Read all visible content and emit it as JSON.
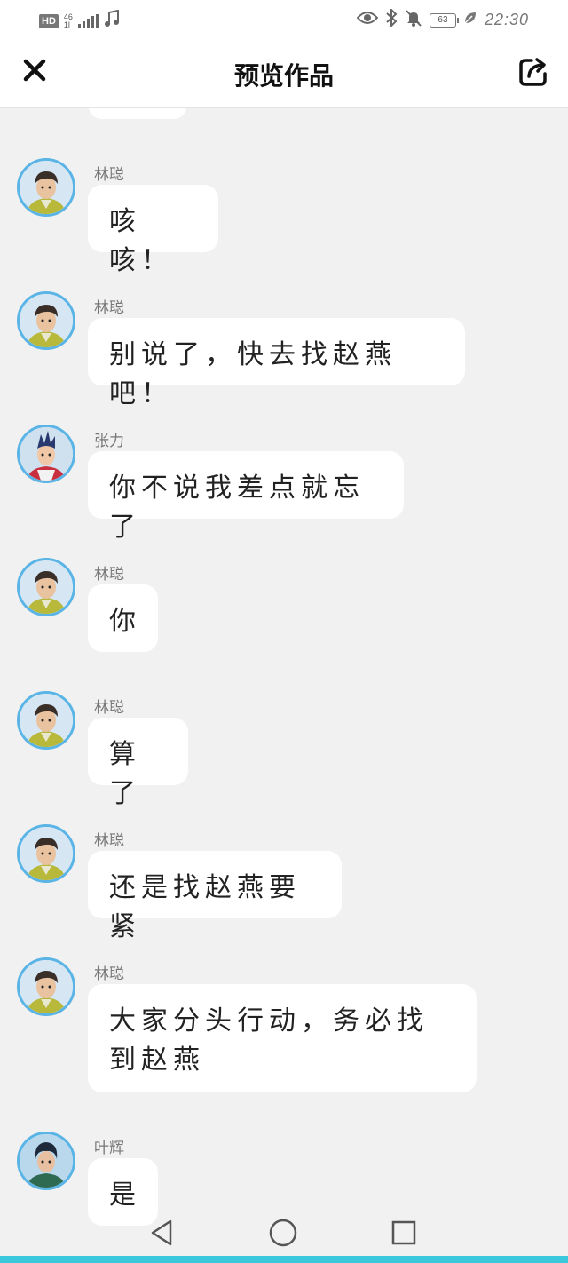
{
  "status_bar": {
    "hd": "HD",
    "network": "46",
    "network_sub": "1l",
    "battery": "63",
    "time": "22:30"
  },
  "header": {
    "title": "预览作品"
  },
  "messages": [
    {
      "sender": "林聪",
      "text": "咳咳！",
      "avatar": "lin-cong"
    },
    {
      "sender": "林聪",
      "text": "别说了，快去找赵燕吧！",
      "avatar": "lin-cong"
    },
    {
      "sender": "张力",
      "text": "你不说我差点就忘了",
      "avatar": "zhang-li"
    },
    {
      "sender": "林聪",
      "text": "你",
      "avatar": "lin-cong"
    },
    {
      "sender": "林聪",
      "text": "算了",
      "avatar": "lin-cong"
    },
    {
      "sender": "林聪",
      "text": "还是找赵燕要紧",
      "avatar": "lin-cong"
    },
    {
      "sender": "林聪",
      "text": "大家分头行动，务必找到赵燕",
      "avatar": "lin-cong"
    },
    {
      "sender": "叶辉",
      "text": "是",
      "avatar": "ye-hui"
    }
  ],
  "icons": {
    "close": "close-icon",
    "share": "share-icon",
    "back": "back-triangle-icon",
    "home": "home-circle-icon",
    "recent": "recent-square-icon"
  },
  "colors": {
    "background": "#f1f1f1",
    "bubble": "#ffffff",
    "avatar_border": "#5ab4e6",
    "accent_bar": "#3cc8dc"
  }
}
